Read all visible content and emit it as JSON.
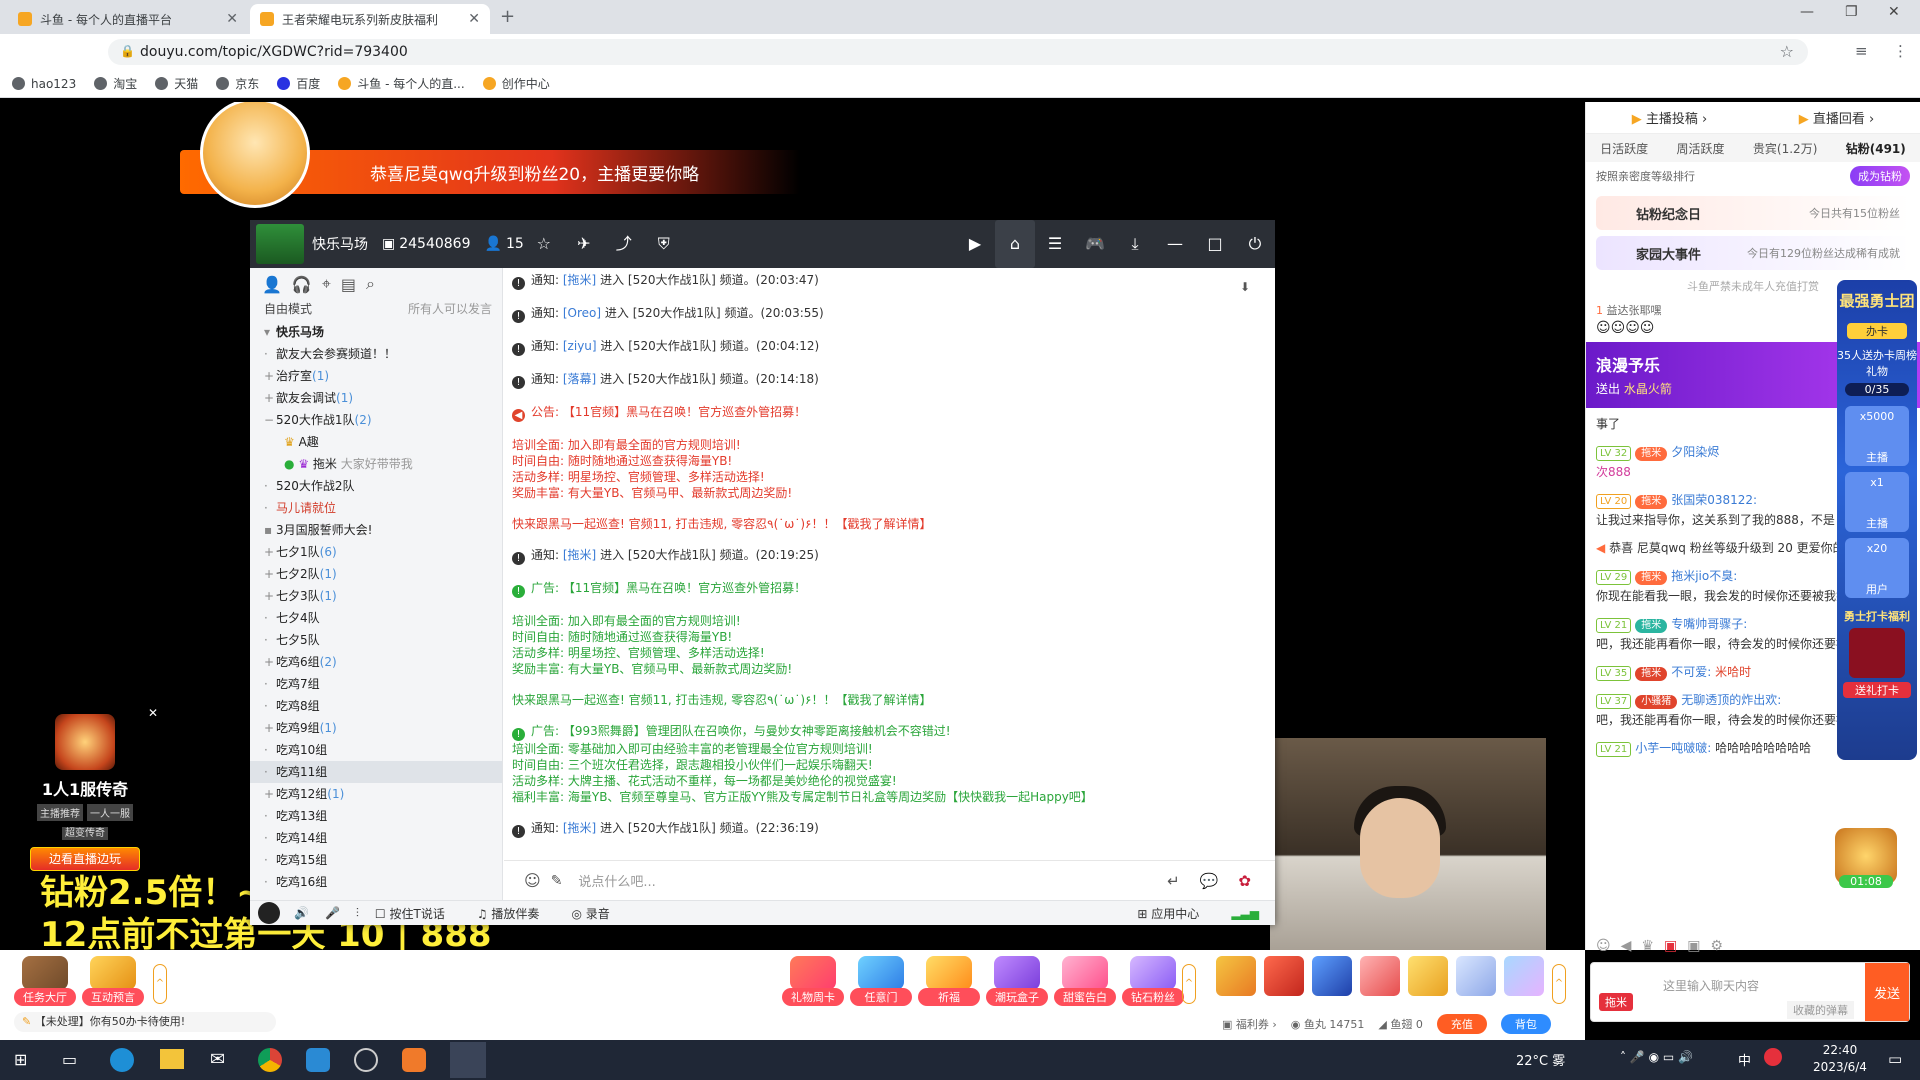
{
  "browser": {
    "tabs": [
      {
        "title": "斗鱼 - 每个人的直播平台"
      },
      {
        "title": "王者荣耀电玩系列新皮肤福利"
      }
    ],
    "url": "douyu.com/topic/XGDWC?rid=793400",
    "bookmarks": [
      "hao123",
      "淘宝",
      "天猫",
      "京东",
      "百度",
      "斗鱼 - 每个人的直...",
      "创作中心"
    ]
  },
  "video": {
    "banner_text": "恭喜尼莫qwq升级到粉丝20，主播更要你略",
    "promo": {
      "title": "1人1服传奇",
      "tags": [
        "主播推荐",
        "一人一服",
        "超变传奇"
      ],
      "cta": "边看直播边玩"
    },
    "subtitle_line1": "钻粉2.5倍！~",
    "subtitle_line2": "12点前不过第一天 10 | 888"
  },
  "yy": {
    "channel_name": "快乐马场",
    "channel_id": "24540869",
    "online_count": "15",
    "mode_label": "自由模式",
    "mode_note": "所有人可以发言",
    "channels": [
      {
        "label": "快乐马场",
        "count": ""
      },
      {
        "label": "歆友大会参赛频道！！",
        "count": ""
      },
      {
        "label": "治疗室",
        "count": "(1)"
      },
      {
        "label": "歆友会调试",
        "count": "(1)"
      },
      {
        "label": "520大作战1队",
        "count": "(2)"
      },
      {
        "label": "A趣",
        "count": ""
      },
      {
        "label": "拖米",
        "count": "大家好带带我"
      },
      {
        "label": "520大作战2队",
        "count": ""
      },
      {
        "label": "马儿请就位",
        "count": ""
      },
      {
        "label": "3月国服誓师大会!",
        "count": ""
      },
      {
        "label": "七夕1队",
        "count": "(6)"
      },
      {
        "label": "七夕2队",
        "count": "(1)"
      },
      {
        "label": "七夕3队",
        "count": "(1)"
      },
      {
        "label": "七夕4队",
        "count": ""
      },
      {
        "label": "七夕5队",
        "count": ""
      },
      {
        "label": "吃鸡6组",
        "count": "(2)"
      },
      {
        "label": "吃鸡7组",
        "count": ""
      },
      {
        "label": "吃鸡8组",
        "count": ""
      },
      {
        "label": "吃鸡9组",
        "count": "(1)"
      },
      {
        "label": "吃鸡10组",
        "count": ""
      },
      {
        "label": "吃鸡11组",
        "count": ""
      },
      {
        "label": "吃鸡12组",
        "count": "(1)"
      },
      {
        "label": "吃鸡13组",
        "count": ""
      },
      {
        "label": "吃鸡14组",
        "count": ""
      },
      {
        "label": "吃鸡15组",
        "count": ""
      },
      {
        "label": "吃鸡16组",
        "count": ""
      }
    ],
    "messages": {
      "n1": {
        "prefix": "通知:",
        "user": "[拖米]",
        "text": "进入 [520大作战1队] 频道。(20:03:47)"
      },
      "n2": {
        "prefix": "通知:",
        "user": "[Oreo]",
        "text": "进入 [520大作战1队] 频道。(20:03:55)"
      },
      "n3": {
        "prefix": "通知:",
        "user": "[ziyu]",
        "text": "进入 [520大作战1队] 频道。(20:04:12)"
      },
      "n4": {
        "prefix": "通知:",
        "user": "[落幕]",
        "text": "进入 [520大作战1队] 频道。(20:14:18)"
      },
      "ad1": "公告: 【11官频】黑马在召唤！官方巡查外管招募！",
      "ad1_lines": [
        "培训全面: 加入即有最全面的官方规则培训!",
        "时间自由: 随时随地通过巡查获得海量YB!",
        "活动多样: 明星场控、官频管理、多样活动选择!",
        "奖励丰富: 有大量YB、官频马甲、最新款式周边奖励!"
      ],
      "ad1_cta": "快来跟黑马一起巡查! 官频11, 打击违规, 零容忍٩(˙ω˙)۶！！【戳我了解详情】",
      "n5": {
        "prefix": "通知:",
        "user": "[拖米]",
        "text": "进入 [520大作战1队] 频道。(20:19:25)"
      },
      "ad2": "广告: 【11官频】黑马在召唤！官方巡查外管招募！",
      "ad3": "广告: 【993熙舞爵】管理团队在召唤你，与曼妙女神零距离接触机会不容错过!",
      "ad3_lines": [
        "培训全面: 零基础加入即可由经验丰富的老管理最全位官方规则培训!",
        "时间自由: 三个班次任君选择，跟志趣相投小伙伴们一起娱乐嗨翻天!",
        "活动多样: 大牌主播、花式活动不重样，每一场都是美妙绝伦的视觉盛宴!",
        "福利丰富: 海量YB、官频至尊皇马、官方正版YY熊及专属定制节日礼盒等周边奖励【快快戳我一起Happy吧】"
      ],
      "n6": {
        "prefix": "通知:",
        "user": "[拖米]",
        "text": "进入 [520大作战1队] 频道。(22:36:19)"
      }
    },
    "input_placeholder": "说点什么吧...",
    "bottom": {
      "ptt": "按住T说话",
      "accomp": "播放伴奏",
      "record": "录音",
      "apps": "应用中心"
    }
  },
  "side": {
    "top_links": [
      "主播投稿",
      "直播回看"
    ],
    "rank_tabs": [
      "日活跃度",
      "周活跃度",
      "贵宾(1.2万)",
      "钻粉(491)"
    ],
    "rank_note": "按照亲密度等级排行",
    "become_diamond": "成为钻粉",
    "card1": {
      "title": "钻粉纪念日",
      "note": "今日共有15位粉丝"
    },
    "card2": {
      "title": "家园大事件",
      "note": "今日有129位粉丝达成稀有成就"
    },
    "safety_note": "斗鱼严禁未成年人充值打赏",
    "rank_user": "益达张耶嘿",
    "gift_banner": {
      "title": "浪漫予乐",
      "action": "送出",
      "gift": "水晶火箭"
    },
    "chat": [
      {
        "lv": "",
        "fan": "",
        "user": "",
        "text": "事了"
      },
      {
        "lv": "LV 32",
        "fan": "拖米",
        "user": "夕阳染烬",
        "text": "次888"
      },
      {
        "lv": "LV 20",
        "fan": "拖米",
        "user": "张国荣038122:",
        "text": "让我过来指导你，这关系到了我的888，不是"
      },
      {
        "lv": "",
        "fan": "",
        "user": "尼莫qwq",
        "text": "恭喜 尼莫qwq 粉丝等级升级到 20 更爱你的"
      },
      {
        "lv": "LV 29",
        "fan": "拖米",
        "user": "拖米jio不臭:",
        "text": "你现在能看我一眼，我会发的时候你还要被我笑"
      },
      {
        "lv": "LV 21",
        "fan": "拖米",
        "user": "专嘴帅哥骤子:",
        "text": "吧，我还能再看你一眼，待会发的时候你还要被我笑"
      },
      {
        "lv": "LV 35",
        "fan": "拖米",
        "user": "不可爱:",
        "text": "米哈时"
      },
      {
        "lv": "LV 37",
        "fan": "小骚猪",
        "user": "无聊透顶的炸出欢:",
        "text": "吧，我还能再看你一眼，待会发的时候你还要被我笑"
      },
      {
        "lv": "LV 21",
        "fan": "",
        "user": "小芋一吨啵啵:",
        "text": "哈哈哈哈哈哈哈哈"
      }
    ],
    "widget": {
      "title": "最强勇士团",
      "card": "办卡",
      "promo": "35人送办卡周榜礼物",
      "progress": "0/35",
      "g1": "x5000",
      "g1l": "主播",
      "g2": "x1",
      "g2l": "主播",
      "g3": "x20",
      "g3l": "用户",
      "daily": "勇士打卡福利",
      "daily_btn": "送礼打卡",
      "timer": "01:08"
    },
    "chat_input_placeholder": "这里输入聊天内容",
    "chat_fan": "拖米",
    "barrage": "收藏的弹幕",
    "send": "发送"
  },
  "giftbar": {
    "left": [
      {
        "label": "任务大厅"
      },
      {
        "label": "互动预言"
      }
    ],
    "gifts": [
      {
        "label": "礼物周卡",
        "badge": "特惠"
      },
      {
        "label": "任意门",
        "badge": "new"
      },
      {
        "label": "祈福",
        "badge": ""
      },
      {
        "label": "潮玩盒子",
        "badge": "精选"
      },
      {
        "label": "甜蜜告白",
        "badge": ""
      },
      {
        "label": "钻石粉丝",
        "badge": ""
      }
    ],
    "notice": "【未处理】你有50办卡待使用!",
    "wallet": {
      "welfare": "福利券",
      "fishball": "鱼丸 14751",
      "fishfin": "鱼翅 0",
      "recharge": "充值",
      "bag": "背包"
    }
  },
  "taskbar": {
    "weather": "22°C 雾",
    "time": "22:40",
    "date": "2023/6/4",
    "ime": "中"
  }
}
